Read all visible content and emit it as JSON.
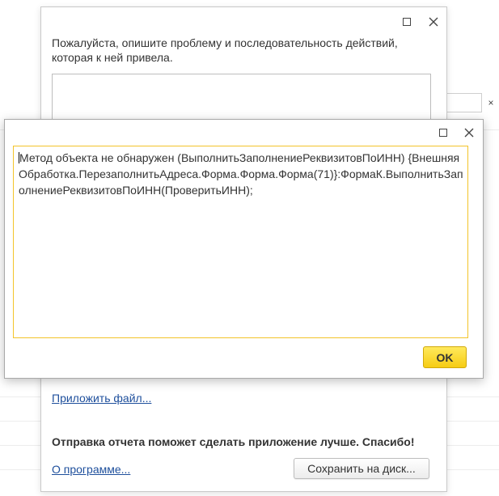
{
  "report_dialog": {
    "prompt": "Пожалуйста, опишите проблему и последовательность действий, которая к ней привела.",
    "attach_link": "Приложить файл...",
    "thanks_text": "Отправка отчета поможет сделать приложение лучше. Спасибо!",
    "about_link": "О программе...",
    "save_button": "Сохранить на диск..."
  },
  "background": {
    "close_glyph": "×"
  },
  "error_dialog": {
    "message": "Метод объекта не обнаружен (ВыполнитьЗаполнениеРеквизитовПоИНН) {ВнешняяОбработка.ПерезаполнитьАдреса.Форма.Форма.Форма(71)}:ФормаК.ВыполнитьЗаполнениеРеквизитовПоИНН(ПроверитьИНН);",
    "ok_button": "OK"
  },
  "colors": {
    "accent_yellow": "#f6cc14",
    "field_border_yellow": "#f3c42a",
    "link_blue": "#1e4f9c"
  }
}
